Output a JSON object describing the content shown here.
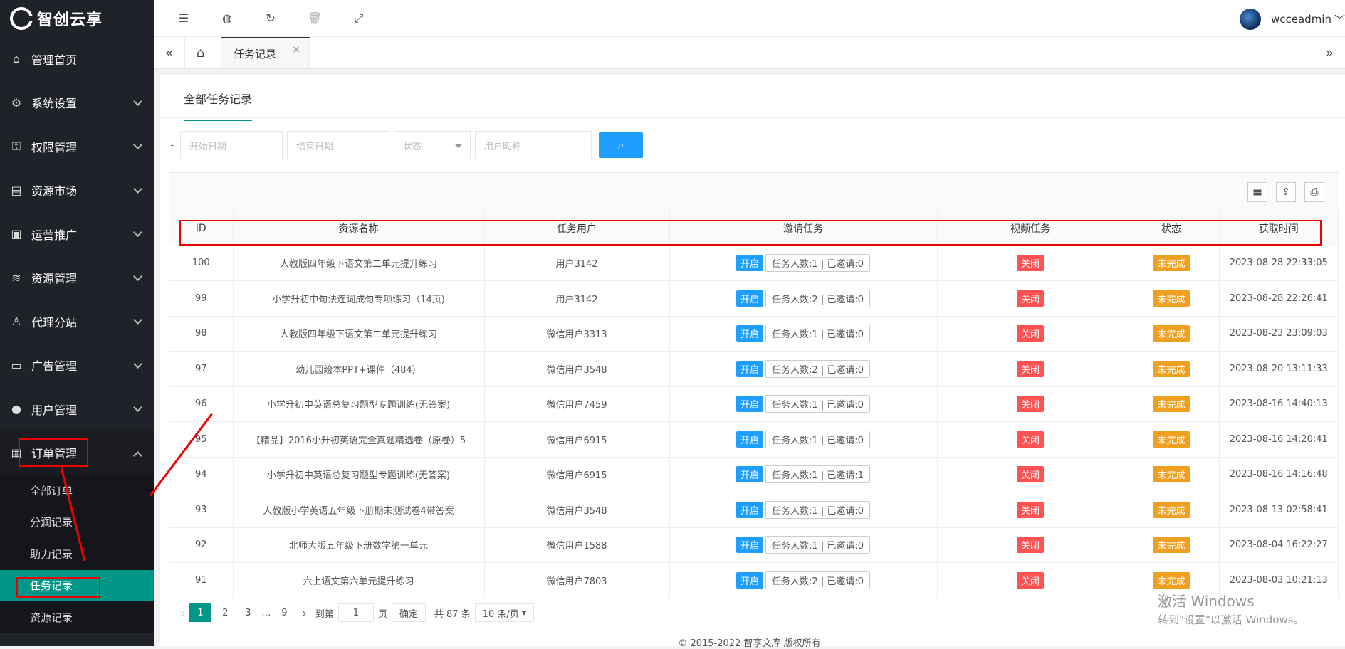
{
  "brand": {
    "logo_text": "智创云享"
  },
  "sidebar": {
    "items": [
      {
        "label": "管理首页",
        "icon": "home-icon"
      },
      {
        "label": "系统设置",
        "icon": "gear-icon"
      },
      {
        "label": "权限管理",
        "icon": "key-user-icon"
      },
      {
        "label": "资源市场",
        "icon": "store-icon"
      },
      {
        "label": "运营推广",
        "icon": "image-icon"
      },
      {
        "label": "资源管理",
        "icon": "layers-icon"
      },
      {
        "label": "代理分站",
        "icon": "agent-icon"
      },
      {
        "label": "广告管理",
        "icon": "ad-icon"
      },
      {
        "label": "用户管理",
        "icon": "user-icon"
      },
      {
        "label": "订单管理",
        "icon": "order-icon"
      }
    ],
    "sub": [
      "全部订单",
      "分润记录",
      "助力记录",
      "任务记录",
      "资源记录"
    ]
  },
  "topbar": {
    "username": "wcceadmin"
  },
  "tabs": {
    "active": "任务记录"
  },
  "card": {
    "title": "全部任务记录"
  },
  "filters": {
    "dash": "-",
    "start": "开始日期",
    "end": "结束日期",
    "status": "状态",
    "nickname": "用户昵称"
  },
  "table": {
    "headers": [
      "ID",
      "资源名称",
      "任务用户",
      "邀请任务",
      "视频任务",
      "状态",
      "获取时间"
    ],
    "on_label": "开启",
    "off_label": "关闭",
    "status_label": "未完成",
    "rows": [
      {
        "id": "100",
        "name": "人教版四年级下语文第二单元提升练习",
        "user": "用户3142",
        "invite": "任务人数:1 | 已邀请:0",
        "time": "2023-08-28 22:33:05"
      },
      {
        "id": "99",
        "name": "小学升初中句法连词成句专项练习（14页)",
        "user": "用户3142",
        "invite": "任务人数:2 | 已邀请:0",
        "time": "2023-08-28 22:26:41"
      },
      {
        "id": "98",
        "name": "人教版四年级下语文第二单元提升练习",
        "user": "微信用户3313",
        "invite": "任务人数:1 | 已邀请:0",
        "time": "2023-08-23 23:09:03"
      },
      {
        "id": "97",
        "name": "幼儿园绘本PPT+课件（484）",
        "user": "微信用户3548",
        "invite": "任务人数:2 | 已邀请:0",
        "time": "2023-08-20 13:11:33"
      },
      {
        "id": "96",
        "name": "小学升初中英语总复习题型专题训练(无答案)",
        "user": "微信用户7459",
        "invite": "任务人数:1 | 已邀请:0",
        "time": "2023-08-16 14:40:13"
      },
      {
        "id": "95",
        "name": "【精品】2016小升初英语完全真题精选卷（原卷）5",
        "user": "微信用户6915",
        "invite": "任务人数:1 | 已邀请:0",
        "time": "2023-08-16 14:20:41"
      },
      {
        "id": "94",
        "name": "小学升初中英语总复习题型专题训练(无答案)",
        "user": "微信用户6915",
        "invite": "任务人数:1 | 已邀请:1",
        "time": "2023-08-16 14:16:48"
      },
      {
        "id": "93",
        "name": "人教版小学英语五年级下册期末测试卷4带答案",
        "user": "微信用户3548",
        "invite": "任务人数:1 | 已邀请:0",
        "time": "2023-08-13 02:58:41"
      },
      {
        "id": "92",
        "name": "北师大版五年级下册数学第一单元",
        "user": "微信用户1588",
        "invite": "任务人数:1 | 已邀请:0",
        "time": "2023-08-04 16:22:27"
      },
      {
        "id": "91",
        "name": "六上语文第六单元提升练习",
        "user": "微信用户7803",
        "invite": "任务人数:2 | 已邀请:0",
        "time": "2023-08-03 10:21:13"
      }
    ]
  },
  "pager": {
    "p1": "1",
    "p2": "2",
    "p3": "3",
    "ellipsis": "…",
    "last": "9",
    "goto": "到第",
    "input": "1",
    "page_unit": "页",
    "confirm": "确定",
    "total": "共 87 条",
    "per_page": "10 条/页"
  },
  "footer": {
    "text": "© 2015-2022 智享文库 版权所有"
  },
  "watermark": {
    "line1": "激活 Windows",
    "line2": "转到\"设置\"以激活 Windows。"
  },
  "colors": {
    "sidebar": "#20222a",
    "active": "#009688",
    "primary": "#1e9fff",
    "danger": "#ff5252",
    "warn": "#f0a020",
    "annotation": "#e00000"
  }
}
